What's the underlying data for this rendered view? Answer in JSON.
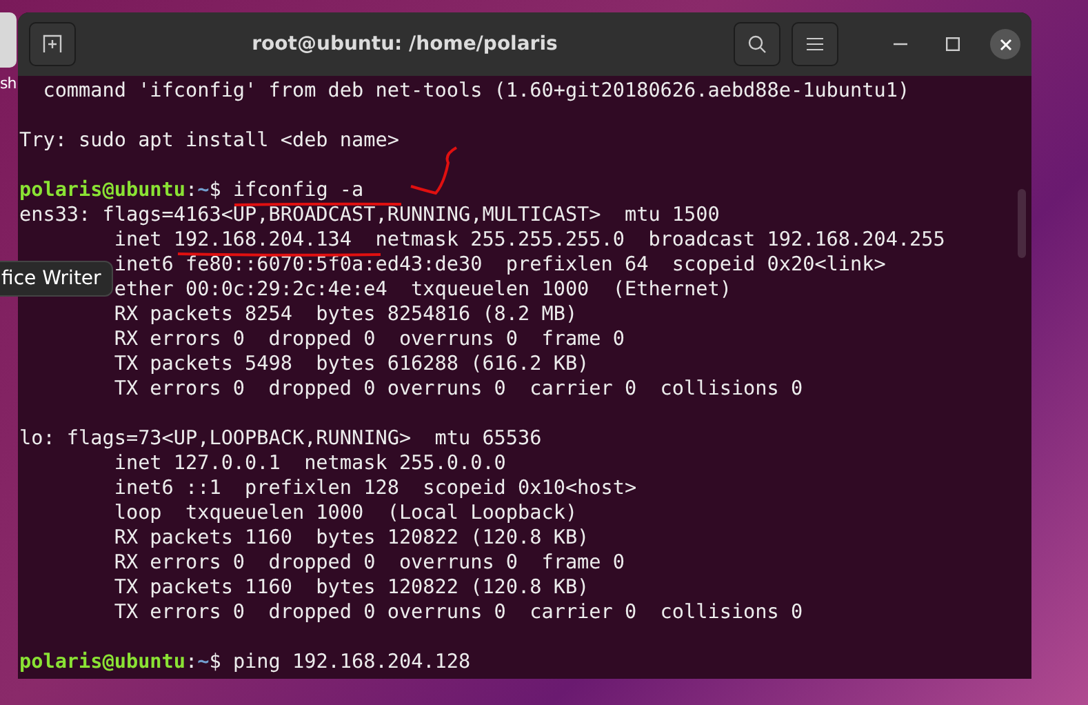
{
  "desktop": {
    "dock_label": "sh",
    "tooltip": "fice Writer"
  },
  "window": {
    "title": "root@ubuntu: /home/polaris"
  },
  "lines": [
    {
      "kind": "text",
      "text": "  command 'ifconfig' from deb net-tools (1.60+git20180626.aebd88e-1ubuntu1)"
    },
    {
      "kind": "blank"
    },
    {
      "kind": "text",
      "text": "Try: sudo apt install <deb name>"
    },
    {
      "kind": "blank"
    },
    {
      "kind": "prompt",
      "user": "polaris@ubuntu",
      "separator": ":",
      "path": "~",
      "symbol": "$",
      "command": " ifconfig -a"
    },
    {
      "kind": "text",
      "text": "ens33: flags=4163<UP,BROADCAST,RUNNING,MULTICAST>  mtu 1500"
    },
    {
      "kind": "indented",
      "text": "inet 192.168.204.134  netmask 255.255.255.0  broadcast 192.168.204.255"
    },
    {
      "kind": "indented",
      "text": "inet6 fe80::6070:5f0a:ed43:de30  prefixlen 64  scopeid 0x20<link>"
    },
    {
      "kind": "indented",
      "text": "ether 00:0c:29:2c:4e:e4  txqueuelen 1000  (Ethernet)"
    },
    {
      "kind": "indented",
      "text": "RX packets 8254  bytes 8254816 (8.2 MB)"
    },
    {
      "kind": "indented",
      "text": "RX errors 0  dropped 0  overruns 0  frame 0"
    },
    {
      "kind": "indented",
      "text": "TX packets 5498  bytes 616288 (616.2 KB)"
    },
    {
      "kind": "indented",
      "text": "TX errors 0  dropped 0 overruns 0  carrier 0  collisions 0"
    },
    {
      "kind": "blank"
    },
    {
      "kind": "text",
      "text": "lo: flags=73<UP,LOOPBACK,RUNNING>  mtu 65536"
    },
    {
      "kind": "indented",
      "text": "inet 127.0.0.1  netmask 255.0.0.0"
    },
    {
      "kind": "indented",
      "text": "inet6 ::1  prefixlen 128  scopeid 0x10<host>"
    },
    {
      "kind": "indented",
      "text": "loop  txqueuelen 1000  (Local Loopback)"
    },
    {
      "kind": "indented",
      "text": "RX packets 1160  bytes 120822 (120.8 KB)"
    },
    {
      "kind": "indented",
      "text": "RX errors 0  dropped 0  overruns 0  frame 0"
    },
    {
      "kind": "indented",
      "text": "TX packets 1160  bytes 120822 (120.8 KB)"
    },
    {
      "kind": "indented",
      "text": "TX errors 0  dropped 0 overruns 0  carrier 0  collisions 0"
    },
    {
      "kind": "blank"
    },
    {
      "kind": "prompt",
      "user": "polaris@ubuntu",
      "separator": ":",
      "path": "~",
      "symbol": "$",
      "command": " ping 192.168.204.128"
    }
  ]
}
